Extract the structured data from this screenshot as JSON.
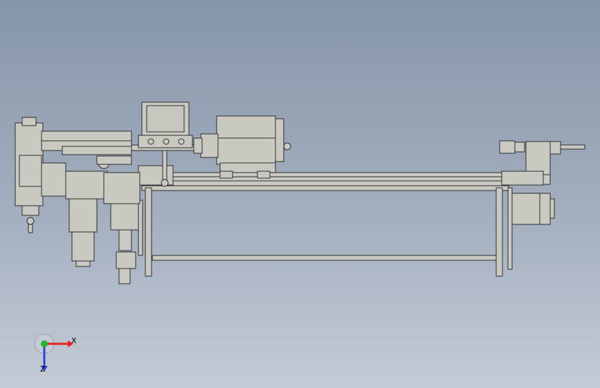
{
  "viewport": {
    "background_top": "#8795a9",
    "background_bottom": "#c4cbd6"
  },
  "model": {
    "part_fill": "#c9c9c1",
    "part_stroke": "#2c2c2c",
    "panel_screen": "#c7c7c0",
    "components": [
      "control-panel",
      "spindle-head",
      "bed-rail",
      "tailstock",
      "servo-motor",
      "left-gearbox",
      "support-frame"
    ]
  },
  "triad": {
    "x_label": "X",
    "z_label": "Z",
    "x_color": "#e8211e",
    "y_color": "#1fb830",
    "z_color": "#2a46d8"
  }
}
